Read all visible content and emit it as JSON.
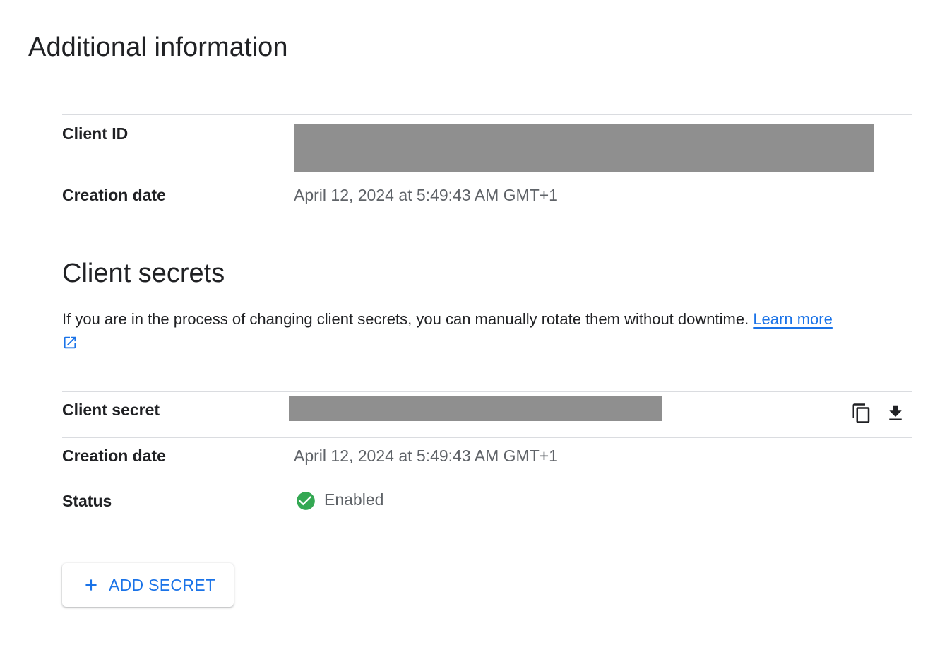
{
  "additional_info": {
    "title": "Additional information",
    "rows": [
      {
        "label": "Client ID",
        "value": ""
      },
      {
        "label": "Creation date",
        "value": "April 12, 2024 at 5:49:43 AM GMT+1"
      }
    ]
  },
  "client_secrets": {
    "title": "Client secrets",
    "description": "If you are in the process of changing client secrets, you can manually rotate them without downtime.",
    "learn_more": "Learn more",
    "rows": [
      {
        "label": "Client secret",
        "value": ""
      },
      {
        "label": "Creation date",
        "value": "April 12, 2024 at 5:49:43 AM GMT+1"
      },
      {
        "label": "Status",
        "value": "Enabled"
      }
    ],
    "add_button": "ADD SECRET"
  },
  "colors": {
    "accent": "#1a73e8",
    "status_enabled": "#34a853",
    "redaction": "#8f8f8f",
    "divider": "#dadce0"
  },
  "icons": {
    "external_link": "open-in-new-icon",
    "copy": "copy-icon",
    "download": "download-icon",
    "status": "check-circle-icon",
    "add": "plus-icon"
  }
}
